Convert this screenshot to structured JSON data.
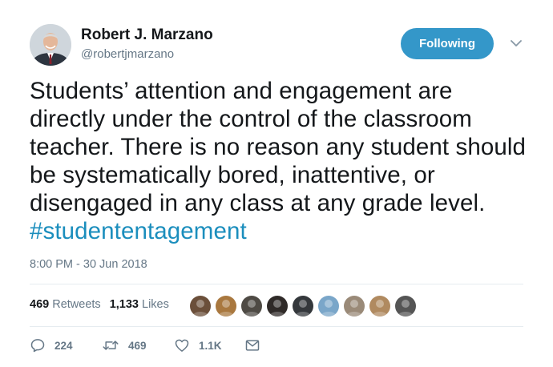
{
  "author": {
    "display_name": "Robert J. Marzano",
    "handle": "@robertjmarzano"
  },
  "follow_button": {
    "label": "Following",
    "color": "#3497c9"
  },
  "tweet": {
    "text": "Students’ attention and engagement are directly under the control of the classroom teacher. There is no reason any student should be systematically bored, inattentive, or disengaged in any class at any grade level.",
    "hashtag": "#studententagement",
    "timestamp": "8:00 PM - 30 Jun 2018"
  },
  "stats": {
    "retweets_count": "469",
    "retweets_label": "Retweets",
    "likes_count": "1,133",
    "likes_label": "Likes"
  },
  "likers": [
    {
      "icon": "user-avatar",
      "color": "#6b4f3a"
    },
    {
      "icon": "user-avatar",
      "color": "#a9783f"
    },
    {
      "icon": "user-avatar",
      "color": "#4e4a44"
    },
    {
      "icon": "user-avatar",
      "color": "#2f2a28"
    },
    {
      "icon": "user-avatar",
      "color": "#34383c"
    },
    {
      "icon": "user-avatar",
      "color": "#7aa6c9"
    },
    {
      "icon": "user-avatar",
      "color": "#9a8a78"
    },
    {
      "icon": "user-avatar",
      "color": "#b08a60"
    },
    {
      "icon": "user-avatar",
      "color": "#555555"
    }
  ],
  "actions": {
    "reply_count": "224",
    "retweet_count": "469",
    "like_count": "1.1K"
  },
  "colors": {
    "link": "#1b8ebd",
    "secondary_text": "#657786",
    "divider": "#e6ecf0"
  }
}
